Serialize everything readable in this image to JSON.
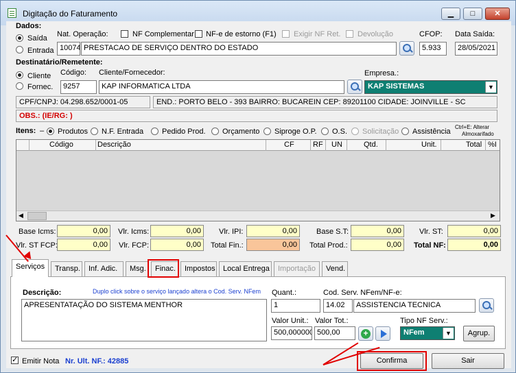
{
  "window": {
    "title": "Digitação do Faturamento",
    "min": "▁",
    "max": "□",
    "close": "✕"
  },
  "dados": {
    "section_label": "Dados:",
    "saida": "Saída",
    "entrada": "Entrada",
    "nat_op_label": "Nat. Operação:",
    "nf_complementar": "NF Complementar",
    "nfe_estorno": "NF-e de estorno (F1)",
    "exigir_nf_ret": "Exigir NF Ret.",
    "devolucao": "Devolução",
    "nat_code": "10074",
    "nat_desc": "PRESTACAO DE SERVIÇO DENTRO DO ESTADO",
    "cfop_label": "CFOP:",
    "cfop": "5.933",
    "data_saida_label": "Data Saída:",
    "data_saida": "28/05/2021"
  },
  "destinatario": {
    "section_label": "Destinatário/Remetente:",
    "cliente": "Cliente",
    "fornec": "Fornec.",
    "codigo_label": "Código:",
    "codigo": "9257",
    "cliente_label": "Cliente/Fornecedor:",
    "cliente_name": "KAP INFORMATICA LTDA",
    "empresa_label": "Empresa.:",
    "empresa": "KAP SISTEMAS",
    "cnpj": "CPF/CNPJ: 04.298.652/0001-05",
    "endereco": "END.: PORTO BELO - 393 BAIRRO: BUCAREIN CEP: 89201100 CIDADE: JOINVILLE - SC",
    "obs": "OBS.: (IE/RG: )"
  },
  "itens": {
    "label": "Itens:",
    "options": [
      "Produtos",
      "N.F. Entrada",
      "Pedido Prod.",
      "Orçamento",
      "Siproge O.P.",
      "O.S.",
      "Solicitação",
      "Assistência"
    ],
    "hint_line1": "Ctrl+E: Alterar",
    "hint_line2": "Almoxarifado",
    "columns": [
      "Código",
      "Descrição",
      "CF",
      "RF",
      "UN",
      "Qtd.",
      "Unit.",
      "Total",
      "%I"
    ]
  },
  "totais": {
    "base_icms_label": "Base Icms:",
    "base_icms": "0,00",
    "vlr_icms_label": "Vlr. Icms:",
    "vlr_icms": "0,00",
    "vlr_ipi_label": "Vlr. IPI:",
    "vlr_ipi": "0,00",
    "base_st_label": "Base S.T:",
    "base_st": "0,00",
    "vlr_st_label": "Vlr. ST:",
    "vlr_st": "0,00",
    "vlr_st_fcp_label": "Vlr. ST FCP:",
    "vlr_st_fcp": "0,00",
    "vlr_fcp_label": "Vlr. FCP:",
    "vlr_fcp": "0,00",
    "total_fin_label": "Total Fin.:",
    "total_fin": "0,00",
    "total_prod_label": "Total Prod.:",
    "total_prod": "0,00",
    "total_nf_label": "Total NF:",
    "total_nf": "0,00"
  },
  "tabs": [
    "Serviços",
    "Transp.",
    "Inf. Adic.",
    "Msg.",
    "Finac.",
    "Impostos",
    "Local Entrega",
    "Importação",
    "Vend."
  ],
  "servicos": {
    "descricao_label": "Descrição:",
    "hint": "Duplo click sobre o serviço lançado altera o Cod. Serv. NFem",
    "descricao": "APRESENTATAÇÃO DO SISTEMA MENTHOR",
    "quant_label": "Quant.:",
    "quant": "1",
    "cod_serv_label": "Cod. Serv. NFem/NF-e:",
    "cod_serv": "14.02",
    "cod_serv_desc": "ASSISTENCIA TECNICA",
    "valor_unit_label": "Valor Unit.:",
    "valor_unit": "500,000000",
    "valor_tot_label": "Valor Tot.:",
    "valor_tot": "500,00",
    "tipo_nf_label": "Tipo NF Serv.:",
    "tipo_nf": "NFem",
    "agrup": "Agrup."
  },
  "footer": {
    "emitir_nota": "Emitir Nota",
    "ult_nf": "Nr. Ult. NF.: 42885",
    "confirma": "Confirma",
    "sair": "Sair"
  },
  "colors": {
    "empresa_bg": "#0e7f72",
    "highlight": "#e10000",
    "yellow": "#ffffc8"
  }
}
